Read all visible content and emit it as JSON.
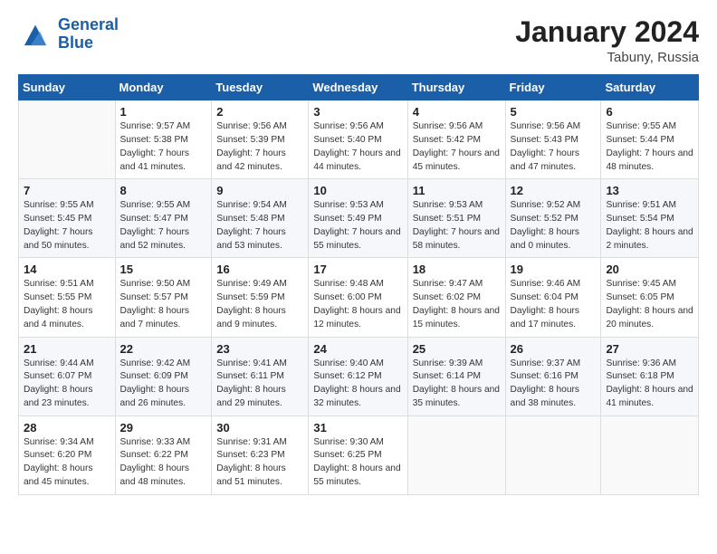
{
  "header": {
    "logo_line1": "General",
    "logo_line2": "Blue",
    "month_title": "January 2024",
    "location": "Tabuny, Russia"
  },
  "days_of_week": [
    "Sunday",
    "Monday",
    "Tuesday",
    "Wednesday",
    "Thursday",
    "Friday",
    "Saturday"
  ],
  "weeks": [
    [
      {
        "day": "",
        "sunrise": "",
        "sunset": "",
        "daylight": ""
      },
      {
        "day": "1",
        "sunrise": "Sunrise: 9:57 AM",
        "sunset": "Sunset: 5:38 PM",
        "daylight": "Daylight: 7 hours and 41 minutes."
      },
      {
        "day": "2",
        "sunrise": "Sunrise: 9:56 AM",
        "sunset": "Sunset: 5:39 PM",
        "daylight": "Daylight: 7 hours and 42 minutes."
      },
      {
        "day": "3",
        "sunrise": "Sunrise: 9:56 AM",
        "sunset": "Sunset: 5:40 PM",
        "daylight": "Daylight: 7 hours and 44 minutes."
      },
      {
        "day": "4",
        "sunrise": "Sunrise: 9:56 AM",
        "sunset": "Sunset: 5:42 PM",
        "daylight": "Daylight: 7 hours and 45 minutes."
      },
      {
        "day": "5",
        "sunrise": "Sunrise: 9:56 AM",
        "sunset": "Sunset: 5:43 PM",
        "daylight": "Daylight: 7 hours and 47 minutes."
      },
      {
        "day": "6",
        "sunrise": "Sunrise: 9:55 AM",
        "sunset": "Sunset: 5:44 PM",
        "daylight": "Daylight: 7 hours and 48 minutes."
      }
    ],
    [
      {
        "day": "7",
        "sunrise": "Sunrise: 9:55 AM",
        "sunset": "Sunset: 5:45 PM",
        "daylight": "Daylight: 7 hours and 50 minutes."
      },
      {
        "day": "8",
        "sunrise": "Sunrise: 9:55 AM",
        "sunset": "Sunset: 5:47 PM",
        "daylight": "Daylight: 7 hours and 52 minutes."
      },
      {
        "day": "9",
        "sunrise": "Sunrise: 9:54 AM",
        "sunset": "Sunset: 5:48 PM",
        "daylight": "Daylight: 7 hours and 53 minutes."
      },
      {
        "day": "10",
        "sunrise": "Sunrise: 9:53 AM",
        "sunset": "Sunset: 5:49 PM",
        "daylight": "Daylight: 7 hours and 55 minutes."
      },
      {
        "day": "11",
        "sunrise": "Sunrise: 9:53 AM",
        "sunset": "Sunset: 5:51 PM",
        "daylight": "Daylight: 7 hours and 58 minutes."
      },
      {
        "day": "12",
        "sunrise": "Sunrise: 9:52 AM",
        "sunset": "Sunset: 5:52 PM",
        "daylight": "Daylight: 8 hours and 0 minutes."
      },
      {
        "day": "13",
        "sunrise": "Sunrise: 9:51 AM",
        "sunset": "Sunset: 5:54 PM",
        "daylight": "Daylight: 8 hours and 2 minutes."
      }
    ],
    [
      {
        "day": "14",
        "sunrise": "Sunrise: 9:51 AM",
        "sunset": "Sunset: 5:55 PM",
        "daylight": "Daylight: 8 hours and 4 minutes."
      },
      {
        "day": "15",
        "sunrise": "Sunrise: 9:50 AM",
        "sunset": "Sunset: 5:57 PM",
        "daylight": "Daylight: 8 hours and 7 minutes."
      },
      {
        "day": "16",
        "sunrise": "Sunrise: 9:49 AM",
        "sunset": "Sunset: 5:59 PM",
        "daylight": "Daylight: 8 hours and 9 minutes."
      },
      {
        "day": "17",
        "sunrise": "Sunrise: 9:48 AM",
        "sunset": "Sunset: 6:00 PM",
        "daylight": "Daylight: 8 hours and 12 minutes."
      },
      {
        "day": "18",
        "sunrise": "Sunrise: 9:47 AM",
        "sunset": "Sunset: 6:02 PM",
        "daylight": "Daylight: 8 hours and 15 minutes."
      },
      {
        "day": "19",
        "sunrise": "Sunrise: 9:46 AM",
        "sunset": "Sunset: 6:04 PM",
        "daylight": "Daylight: 8 hours and 17 minutes."
      },
      {
        "day": "20",
        "sunrise": "Sunrise: 9:45 AM",
        "sunset": "Sunset: 6:05 PM",
        "daylight": "Daylight: 8 hours and 20 minutes."
      }
    ],
    [
      {
        "day": "21",
        "sunrise": "Sunrise: 9:44 AM",
        "sunset": "Sunset: 6:07 PM",
        "daylight": "Daylight: 8 hours and 23 minutes."
      },
      {
        "day": "22",
        "sunrise": "Sunrise: 9:42 AM",
        "sunset": "Sunset: 6:09 PM",
        "daylight": "Daylight: 8 hours and 26 minutes."
      },
      {
        "day": "23",
        "sunrise": "Sunrise: 9:41 AM",
        "sunset": "Sunset: 6:11 PM",
        "daylight": "Daylight: 8 hours and 29 minutes."
      },
      {
        "day": "24",
        "sunrise": "Sunrise: 9:40 AM",
        "sunset": "Sunset: 6:12 PM",
        "daylight": "Daylight: 8 hours and 32 minutes."
      },
      {
        "day": "25",
        "sunrise": "Sunrise: 9:39 AM",
        "sunset": "Sunset: 6:14 PM",
        "daylight": "Daylight: 8 hours and 35 minutes."
      },
      {
        "day": "26",
        "sunrise": "Sunrise: 9:37 AM",
        "sunset": "Sunset: 6:16 PM",
        "daylight": "Daylight: 8 hours and 38 minutes."
      },
      {
        "day": "27",
        "sunrise": "Sunrise: 9:36 AM",
        "sunset": "Sunset: 6:18 PM",
        "daylight": "Daylight: 8 hours and 41 minutes."
      }
    ],
    [
      {
        "day": "28",
        "sunrise": "Sunrise: 9:34 AM",
        "sunset": "Sunset: 6:20 PM",
        "daylight": "Daylight: 8 hours and 45 minutes."
      },
      {
        "day": "29",
        "sunrise": "Sunrise: 9:33 AM",
        "sunset": "Sunset: 6:22 PM",
        "daylight": "Daylight: 8 hours and 48 minutes."
      },
      {
        "day": "30",
        "sunrise": "Sunrise: 9:31 AM",
        "sunset": "Sunset: 6:23 PM",
        "daylight": "Daylight: 8 hours and 51 minutes."
      },
      {
        "day": "31",
        "sunrise": "Sunrise: 9:30 AM",
        "sunset": "Sunset: 6:25 PM",
        "daylight": "Daylight: 8 hours and 55 minutes."
      },
      {
        "day": "",
        "sunrise": "",
        "sunset": "",
        "daylight": ""
      },
      {
        "day": "",
        "sunrise": "",
        "sunset": "",
        "daylight": ""
      },
      {
        "day": "",
        "sunrise": "",
        "sunset": "",
        "daylight": ""
      }
    ]
  ]
}
